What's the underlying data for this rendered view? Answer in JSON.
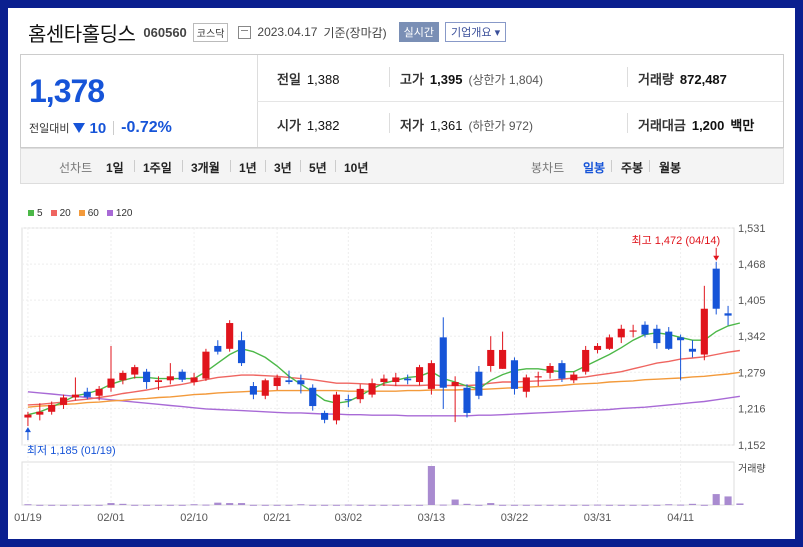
{
  "header": {
    "name": "홈센타홀딩스",
    "code": "060560",
    "market": "코스닥",
    "date": "2023.04.17",
    "date_suffix": "기준(장마감)",
    "live": "실시간",
    "overview": "기업개요"
  },
  "quote": {
    "price": "1,378",
    "change_label": "전일대비",
    "change": "10",
    "change_pct": "-0.72%",
    "prev_label": "전일",
    "prev": "1,388",
    "high_label": "고가",
    "high": "1,395",
    "upper_limit": "(상한가 1,804)",
    "vol_label": "거래량",
    "vol": "872,487",
    "open_label": "시가",
    "open": "1,382",
    "low_label": "저가",
    "low": "1,361",
    "lower_limit": "(하한가 972)",
    "amount_label": "거래대금",
    "amount": "1,200",
    "amount_unit": "백만"
  },
  "tabs": {
    "line_label": "선차트",
    "line_items": [
      "1일",
      "1주일",
      "3개월",
      "1년",
      "3년",
      "5년",
      "10년"
    ],
    "candle_label": "봉차트",
    "candle_items": [
      "일봉",
      "주봉",
      "월봉"
    ]
  },
  "colors": {
    "up": "#e0141c",
    "down": "#1654d8",
    "ma5": "#4cb848",
    "ma20": "#ef6560",
    "ma60": "#f39a3b",
    "ma120": "#a86ad6",
    "volume": "#a98bd0"
  },
  "chart_data": {
    "type": "candlestick",
    "legend": [
      "5",
      "20",
      "60",
      "120"
    ],
    "ylim": [
      1152,
      1531
    ],
    "yticks": [
      1531,
      1468,
      1405,
      1342,
      1279,
      1216,
      1152
    ],
    "xticks": [
      "01/19",
      "02/01",
      "02/10",
      "02/21",
      "03/02",
      "03/13",
      "03/22",
      "03/31",
      "04/11"
    ],
    "volume_label": "거래량",
    "max_label": "최고 1,472 (04/14)",
    "min_label": "최저 1,185 (01/19)",
    "candles": [
      {
        "d": "01/19",
        "o": 1200,
        "h": 1210,
        "l": 1185,
        "c": 1205
      },
      {
        "d": "01/20",
        "o": 1205,
        "h": 1225,
        "l": 1195,
        "c": 1210
      },
      {
        "d": "01/25",
        "o": 1210,
        "h": 1228,
        "l": 1205,
        "c": 1222
      },
      {
        "d": "01/26",
        "o": 1222,
        "h": 1240,
        "l": 1215,
        "c": 1235
      },
      {
        "d": "01/27",
        "o": 1235,
        "h": 1270,
        "l": 1230,
        "c": 1240
      },
      {
        "d": "01/30",
        "o": 1245,
        "h": 1252,
        "l": 1232,
        "c": 1236
      },
      {
        "d": "01/31",
        "o": 1238,
        "h": 1255,
        "l": 1230,
        "c": 1250
      },
      {
        "d": "02/01",
        "o": 1252,
        "h": 1325,
        "l": 1245,
        "c": 1268
      },
      {
        "d": "02/02",
        "o": 1265,
        "h": 1282,
        "l": 1258,
        "c": 1278
      },
      {
        "d": "02/03",
        "o": 1275,
        "h": 1292,
        "l": 1268,
        "c": 1288
      },
      {
        "d": "02/06",
        "o": 1280,
        "h": 1285,
        "l": 1250,
        "c": 1262
      },
      {
        "d": "02/07",
        "o": 1262,
        "h": 1272,
        "l": 1248,
        "c": 1265
      },
      {
        "d": "02/08",
        "o": 1265,
        "h": 1295,
        "l": 1258,
        "c": 1272
      },
      {
        "d": "02/09",
        "o": 1280,
        "h": 1284,
        "l": 1262,
        "c": 1266
      },
      {
        "d": "02/10",
        "o": 1262,
        "h": 1278,
        "l": 1256,
        "c": 1270
      },
      {
        "d": "02/13",
        "o": 1268,
        "h": 1320,
        "l": 1264,
        "c": 1315
      },
      {
        "d": "02/14",
        "o": 1325,
        "h": 1335,
        "l": 1310,
        "c": 1315
      },
      {
        "d": "02/15",
        "o": 1320,
        "h": 1370,
        "l": 1315,
        "c": 1365
      },
      {
        "d": "02/16",
        "o": 1335,
        "h": 1350,
        "l": 1290,
        "c": 1295
      },
      {
        "d": "02/17",
        "o": 1255,
        "h": 1262,
        "l": 1232,
        "c": 1240
      },
      {
        "d": "02/20",
        "o": 1238,
        "h": 1268,
        "l": 1232,
        "c": 1265
      },
      {
        "d": "02/21",
        "o": 1255,
        "h": 1275,
        "l": 1248,
        "c": 1270
      },
      {
        "d": "02/22",
        "o": 1265,
        "h": 1282,
        "l": 1258,
        "c": 1262
      },
      {
        "d": "02/23",
        "o": 1265,
        "h": 1275,
        "l": 1242,
        "c": 1258
      },
      {
        "d": "02/24",
        "o": 1252,
        "h": 1258,
        "l": 1212,
        "c": 1220
      },
      {
        "d": "02/27",
        "o": 1208,
        "h": 1212,
        "l": 1190,
        "c": 1196
      },
      {
        "d": "02/28",
        "o": 1195,
        "h": 1245,
        "l": 1188,
        "c": 1240
      },
      {
        "d": "03/02",
        "o": 1232,
        "h": 1240,
        "l": 1218,
        "c": 1230
      },
      {
        "d": "03/03",
        "o": 1232,
        "h": 1258,
        "l": 1225,
        "c": 1250
      },
      {
        "d": "03/06",
        "o": 1240,
        "h": 1268,
        "l": 1235,
        "c": 1260
      },
      {
        "d": "03/07",
        "o": 1262,
        "h": 1275,
        "l": 1255,
        "c": 1268
      },
      {
        "d": "03/08",
        "o": 1262,
        "h": 1278,
        "l": 1255,
        "c": 1270
      },
      {
        "d": "03/09",
        "o": 1268,
        "h": 1275,
        "l": 1258,
        "c": 1265
      },
      {
        "d": "03/10",
        "o": 1262,
        "h": 1292,
        "l": 1256,
        "c": 1288
      },
      {
        "d": "03/13",
        "o": 1250,
        "h": 1300,
        "l": 1240,
        "c": 1295
      },
      {
        "d": "03/14",
        "o": 1340,
        "h": 1375,
        "l": 1215,
        "c": 1252
      },
      {
        "d": "03/15",
        "o": 1255,
        "h": 1272,
        "l": 1192,
        "c": 1262
      },
      {
        "d": "03/16",
        "o": 1252,
        "h": 1258,
        "l": 1200,
        "c": 1208
      },
      {
        "d": "03/17",
        "o": 1280,
        "h": 1290,
        "l": 1232,
        "c": 1238
      },
      {
        "d": "03/20",
        "o": 1290,
        "h": 1342,
        "l": 1280,
        "c": 1318
      },
      {
        "d": "03/21",
        "o": 1285,
        "h": 1350,
        "l": 1285,
        "c": 1318
      },
      {
        "d": "03/22",
        "o": 1300,
        "h": 1305,
        "l": 1240,
        "c": 1250
      },
      {
        "d": "03/23",
        "o": 1245,
        "h": 1275,
        "l": 1235,
        "c": 1270
      },
      {
        "d": "03/24",
        "o": 1270,
        "h": 1280,
        "l": 1255,
        "c": 1272
      },
      {
        "d": "03/27",
        "o": 1278,
        "h": 1295,
        "l": 1268,
        "c": 1290
      },
      {
        "d": "03/28",
        "o": 1295,
        "h": 1300,
        "l": 1262,
        "c": 1268
      },
      {
        "d": "03/29",
        "o": 1265,
        "h": 1280,
        "l": 1260,
        "c": 1275
      },
      {
        "d": "03/30",
        "o": 1280,
        "h": 1325,
        "l": 1275,
        "c": 1318
      },
      {
        "d": "03/31",
        "o": 1318,
        "h": 1330,
        "l": 1312,
        "c": 1325
      },
      {
        "d": "04/03",
        "o": 1320,
        "h": 1345,
        "l": 1318,
        "c": 1340
      },
      {
        "d": "04/04",
        "o": 1340,
        "h": 1362,
        "l": 1330,
        "c": 1355
      },
      {
        "d": "04/05",
        "o": 1350,
        "h": 1362,
        "l": 1340,
        "c": 1352
      },
      {
        "d": "04/06",
        "o": 1362,
        "h": 1368,
        "l": 1340,
        "c": 1345
      },
      {
        "d": "04/07",
        "o": 1355,
        "h": 1362,
        "l": 1320,
        "c": 1330
      },
      {
        "d": "04/10",
        "o": 1350,
        "h": 1358,
        "l": 1318,
        "c": 1320
      },
      {
        "d": "04/11",
        "o": 1340,
        "h": 1345,
        "l": 1265,
        "c": 1335
      },
      {
        "d": "04/12",
        "o": 1320,
        "h": 1335,
        "l": 1305,
        "c": 1315
      },
      {
        "d": "04/13",
        "o": 1310,
        "h": 1430,
        "l": 1300,
        "c": 1390
      },
      {
        "d": "04/14",
        "o": 1460,
        "h": 1472,
        "l": 1380,
        "c": 1390
      },
      {
        "d": "04/17",
        "o": 1382,
        "h": 1395,
        "l": 1361,
        "c": 1378
      }
    ],
    "volumes": [
      0.02,
      0.005,
      0.005,
      0.005,
      0.005,
      0.005,
      0.005,
      0.05,
      0.03,
      0.005,
      0.005,
      0.005,
      0.005,
      0.005,
      0.02,
      0.01,
      0.06,
      0.05,
      0.05,
      0.005,
      0.005,
      0.005,
      0.005,
      0.02,
      0.005,
      0.005,
      0.005,
      0.01,
      0.005,
      0.005,
      0.005,
      0.005,
      0.005,
      0.005,
      1.0,
      0.01,
      0.14,
      0.03,
      0.005,
      0.05,
      0.005,
      0.005,
      0.005,
      0.005,
      0.005,
      0.005,
      0.005,
      0.005,
      0.01,
      0.005,
      0.005,
      0.005,
      0.005,
      0.005,
      0.02,
      0.01,
      0.03,
      0.005,
      0.28,
      0.22,
      0.04
    ],
    "ma5": [
      1205,
      1210,
      1218,
      1228,
      1238,
      1242,
      1248,
      1258,
      1265,
      1270,
      1270,
      1268,
      1268,
      1268,
      1268,
      1280,
      1295,
      1310,
      1320,
      1315,
      1305,
      1290,
      1272,
      1258,
      1245,
      1230,
      1225,
      1228,
      1238,
      1250,
      1260,
      1265,
      1270,
      1272,
      1280,
      1268,
      1262,
      1255,
      1250,
      1265,
      1275,
      1282,
      1285,
      1285,
      1282,
      1280,
      1280,
      1290,
      1300,
      1310,
      1322,
      1335,
      1345,
      1348,
      1345,
      1340,
      1335,
      1335,
      1350,
      1360,
      1365
    ],
    "ma20": [
      1222,
      1223,
      1225,
      1227,
      1230,
      1232,
      1235,
      1238,
      1242,
      1245,
      1248,
      1252,
      1255,
      1258,
      1262,
      1266,
      1270,
      1272,
      1274,
      1274,
      1273,
      1272,
      1270,
      1268,
      1266,
      1263,
      1260,
      1260,
      1259,
      1258,
      1257,
      1256,
      1256,
      1256,
      1257,
      1256,
      1256,
      1256,
      1257,
      1260,
      1262,
      1262,
      1263,
      1264,
      1265,
      1267,
      1269,
      1271,
      1274,
      1277,
      1280,
      1285,
      1290,
      1295,
      1298,
      1302,
      1304,
      1306,
      1310,
      1314,
      1317
    ],
    "ma60": [
      1218,
      1220,
      1221,
      1223,
      1224,
      1226,
      1227,
      1229,
      1230,
      1232,
      1233,
      1235,
      1236,
      1238,
      1240,
      1241,
      1243,
      1244,
      1245,
      1246,
      1246,
      1247,
      1247,
      1247,
      1247,
      1247,
      1247,
      1246,
      1246,
      1246,
      1246,
      1246,
      1247,
      1247,
      1248,
      1248,
      1248,
      1249,
      1249,
      1250,
      1251,
      1252,
      1253,
      1254,
      1255,
      1256,
      1258,
      1259,
      1260,
      1262,
      1263,
      1264,
      1266,
      1267,
      1268,
      1269,
      1271,
      1272,
      1274,
      1276,
      1279
    ],
    "ma120": [
      1245,
      1243,
      1241,
      1239,
      1237,
      1235,
      1233,
      1231,
      1229,
      1227,
      1225,
      1223,
      1221,
      1219,
      1217,
      1215,
      1214,
      1213,
      1212,
      1211,
      1210,
      1209,
      1208,
      1208,
      1207,
      1206,
      1206,
      1205,
      1205,
      1204,
      1204,
      1204,
      1203,
      1203,
      1203,
      1203,
      1203,
      1203,
      1204,
      1204,
      1205,
      1206,
      1207,
      1208,
      1209,
      1210,
      1211,
      1212,
      1213,
      1214,
      1216,
      1217,
      1218,
      1220,
      1222,
      1224,
      1226,
      1228,
      1231,
      1234,
      1237
    ]
  }
}
